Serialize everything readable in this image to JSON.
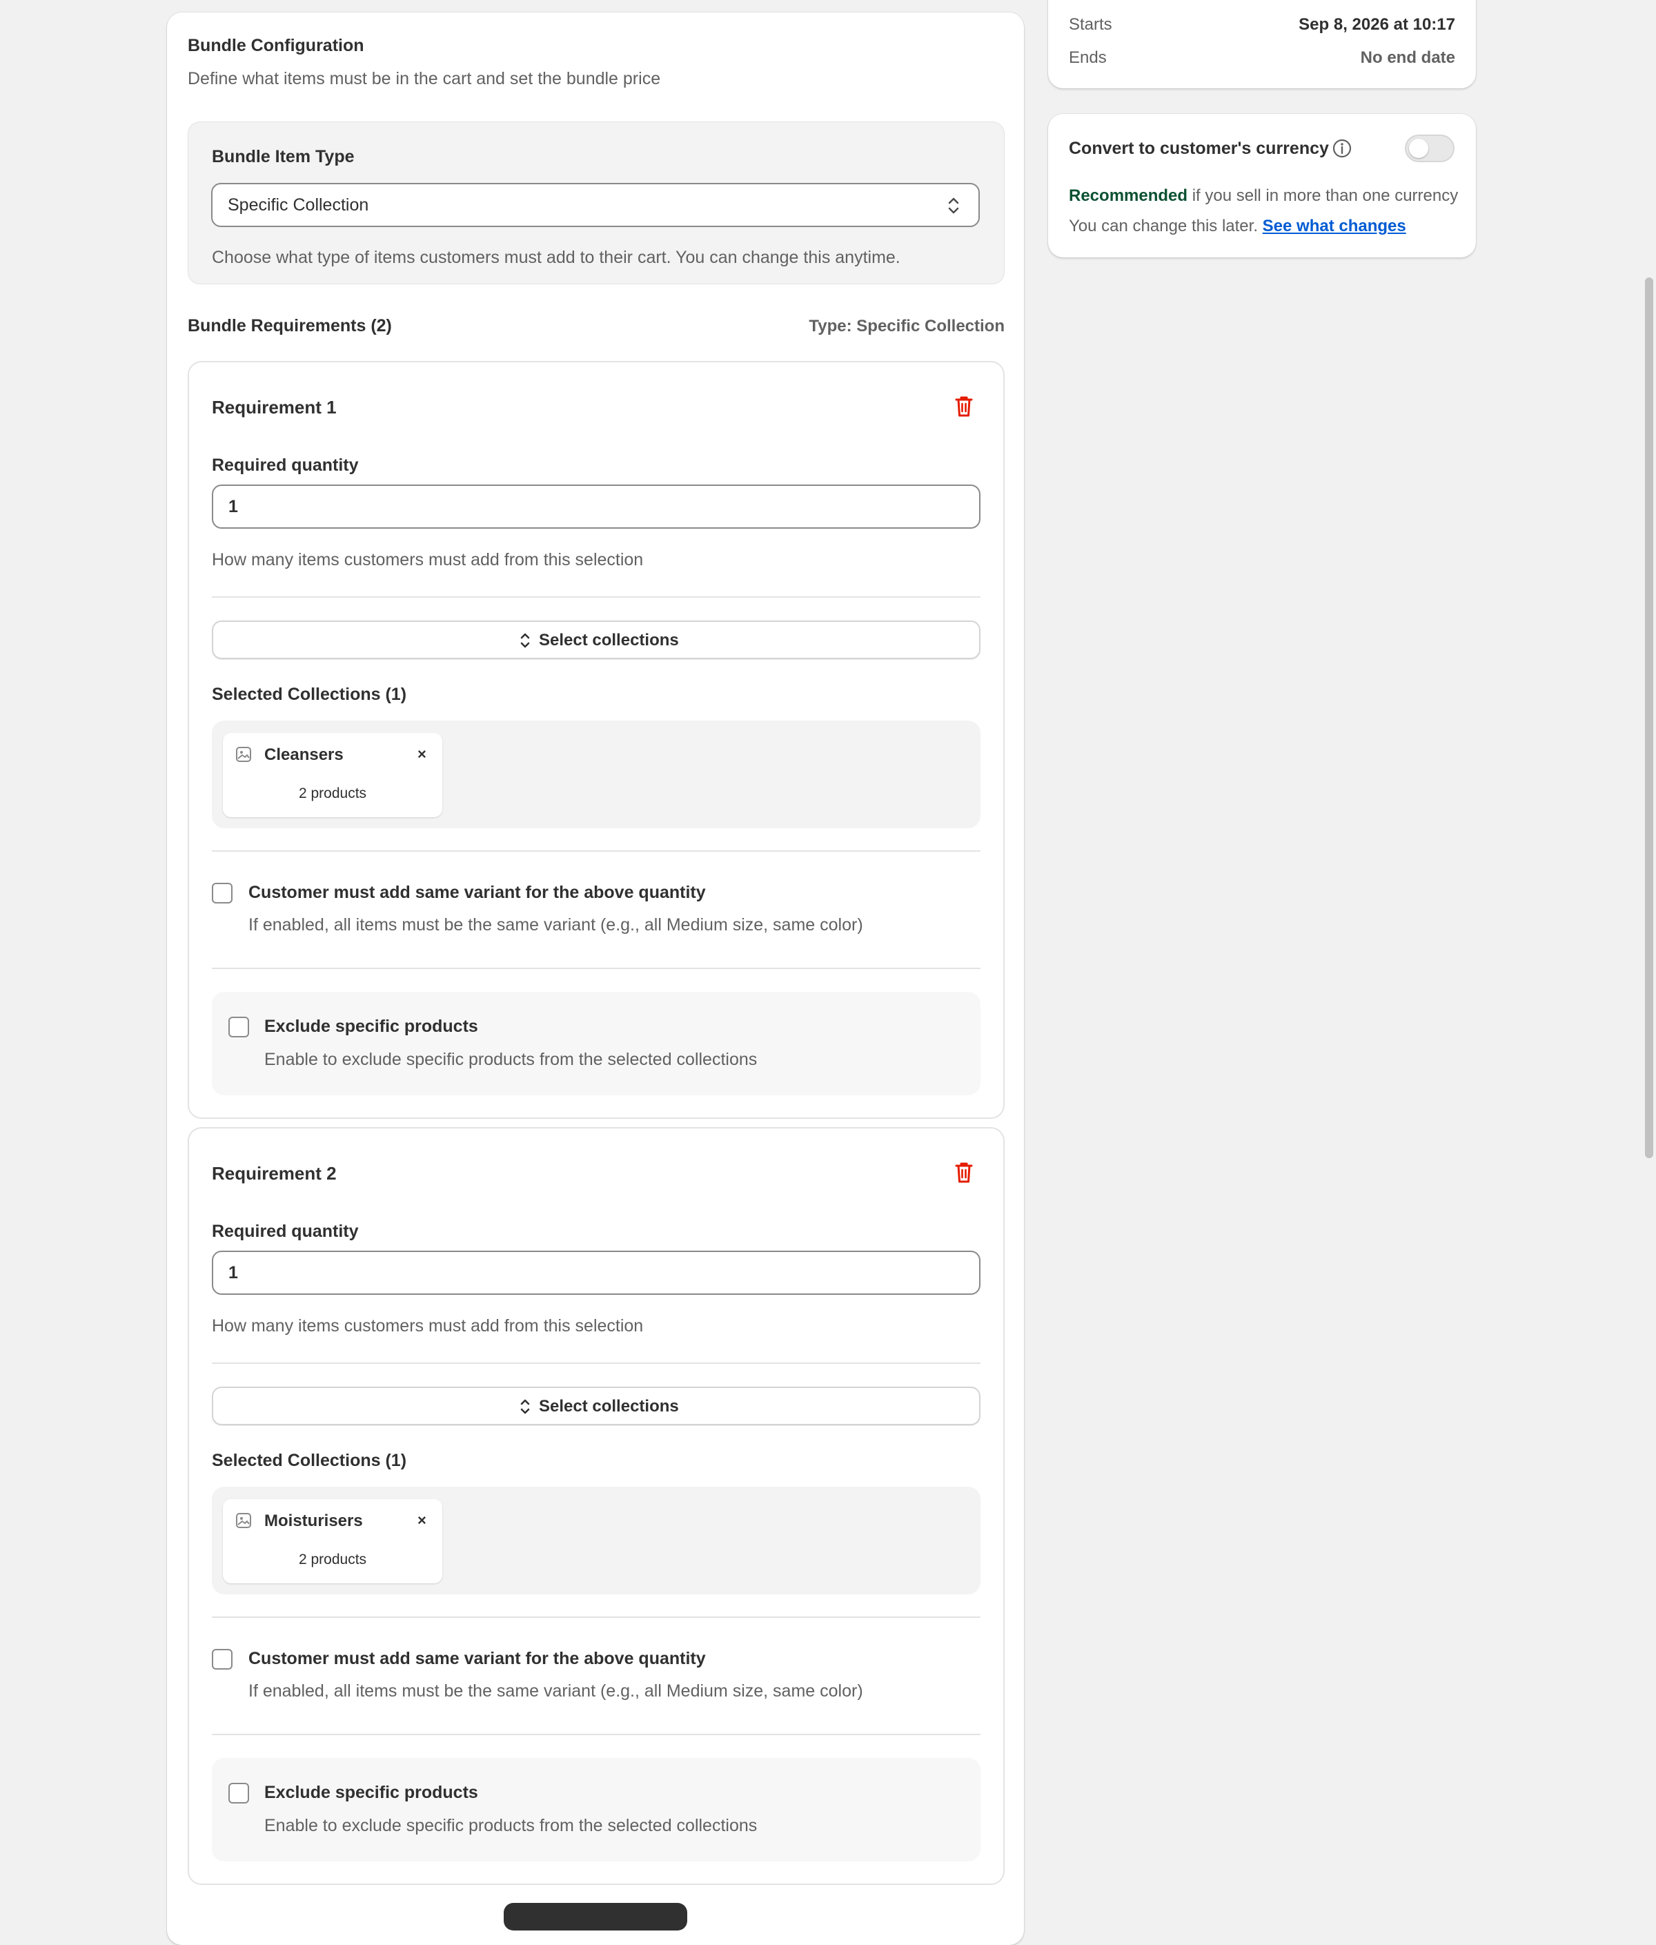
{
  "schedule": {
    "starts_label": "Starts",
    "starts_value": "Sep 8, 2026 at 10:17",
    "ends_label": "Ends",
    "ends_value": "No end date"
  },
  "currency": {
    "title": "Convert to customer's currency",
    "toggle_on": false,
    "recommended": "Recommended",
    "recommended_rest": " if you sell in more than one currency",
    "change_later": "You can change this later. ",
    "link": "See what changes"
  },
  "bundle": {
    "title": "Bundle Configuration",
    "subtitle": "Define what items must be in the cart and set the bundle price",
    "item_type_label": "Bundle Item Type",
    "item_type_value": "Specific Collection",
    "item_type_help": "Choose what type of items customers must add to their cart. You can change this anytime.",
    "requirements_heading": "Bundle Requirements (2)",
    "requirements_type": "Type: Specific Collection",
    "requirements": [
      {
        "title": "Requirement 1",
        "qty_label": "Required quantity",
        "qty_value": "1",
        "qty_help": "How many items customers must add from this selection",
        "select_button": "Select collections",
        "selected_heading": "Selected Collections (1)",
        "chip_name": "Cleansers",
        "chip_count": "2 products",
        "same_variant_label": "Customer must add same variant for the above quantity",
        "same_variant_help": "If enabled, all items must be the same variant (e.g., all Medium size, same color)",
        "exclude_label": "Exclude specific products",
        "exclude_help": "Enable to exclude specific products from the selected collections"
      },
      {
        "title": "Requirement 2",
        "qty_label": "Required quantity",
        "qty_value": "1",
        "qty_help": "How many items customers must add from this selection",
        "select_button": "Select collections",
        "selected_heading": "Selected Collections (1)",
        "chip_name": "Moisturisers",
        "chip_count": "2 products",
        "same_variant_label": "Customer must add same variant for the above quantity",
        "same_variant_help": "If enabled, all items must be the same variant (e.g., all Medium size, same color)",
        "exclude_label": "Exclude specific products",
        "exclude_help": "Enable to exclude specific products from the selected collections"
      }
    ]
  },
  "colors": {
    "delete_icon": "#e51c00",
    "link": "#005bd3",
    "recommended": "#0c5132"
  }
}
